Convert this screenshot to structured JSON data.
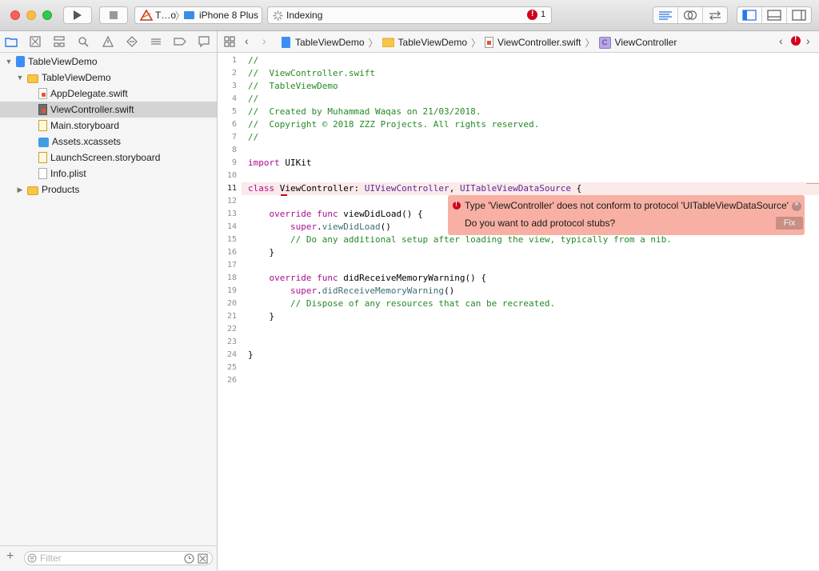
{
  "toolbar": {
    "scheme_name": "T…o",
    "device": "iPhone 8 Plus",
    "activity_text": "Indexing",
    "error_count": "1"
  },
  "navigator": {
    "tree": [
      {
        "label": "TableViewDemo",
        "icon": "project-icon",
        "level": 0,
        "disclosure": "open"
      },
      {
        "label": "TableViewDemo",
        "icon": "folder-icon",
        "level": 1,
        "disclosure": "open"
      },
      {
        "label": "AppDelegate.swift",
        "icon": "swift-file-icon",
        "level": 2
      },
      {
        "label": "ViewController.swift",
        "icon": "swift-file-icon",
        "level": 2,
        "selected": true
      },
      {
        "label": "Main.storyboard",
        "icon": "storyboard-file-icon",
        "level": 2
      },
      {
        "label": "Assets.xcassets",
        "icon": "asset-catalog-icon",
        "level": 2
      },
      {
        "label": "LaunchScreen.storyboard",
        "icon": "storyboard-file-icon",
        "level": 2
      },
      {
        "label": "Info.plist",
        "icon": "plist-file-icon",
        "level": 2
      },
      {
        "label": "Products",
        "icon": "folder-icon",
        "level": 1,
        "disclosure": "closed"
      }
    ],
    "filter_placeholder": "Filter"
  },
  "jumpbar": {
    "crumbs": [
      "TableViewDemo",
      "TableViewDemo",
      "ViewController.swift",
      "ViewController"
    ]
  },
  "editor": {
    "lines": [
      {
        "n": "1",
        "segs": [
          [
            "cm",
            "//"
          ]
        ]
      },
      {
        "n": "2",
        "segs": [
          [
            "cm",
            "//  ViewController.swift"
          ]
        ]
      },
      {
        "n": "3",
        "segs": [
          [
            "cm",
            "//  TableViewDemo"
          ]
        ]
      },
      {
        "n": "4",
        "segs": [
          [
            "cm",
            "//"
          ]
        ]
      },
      {
        "n": "5",
        "segs": [
          [
            "cm",
            "//  Created by Muhammad Waqas on 21/03/2018."
          ]
        ]
      },
      {
        "n": "6",
        "segs": [
          [
            "cm",
            "//  Copyright © 2018 ZZZ Projects. All rights reserved."
          ]
        ]
      },
      {
        "n": "7",
        "segs": [
          [
            "cm",
            "//"
          ]
        ]
      },
      {
        "n": "8",
        "segs": []
      },
      {
        "n": "9",
        "segs": [
          [
            "kw",
            "import"
          ],
          [
            "pl",
            " UIKit"
          ]
        ]
      },
      {
        "n": "10",
        "segs": []
      },
      {
        "n": "11",
        "segs": [
          [
            "kw",
            "class"
          ],
          [
            "pl",
            " ViewController: "
          ],
          [
            "ty",
            "UIViewController"
          ],
          [
            "pl",
            ", "
          ],
          [
            "ty",
            "UITableViewDataSource"
          ],
          [
            "pl",
            " {"
          ]
        ],
        "current": true
      },
      {
        "n": "12",
        "segs": []
      },
      {
        "n": "13",
        "segs": [
          [
            "pl",
            "    "
          ],
          [
            "kw",
            "override"
          ],
          [
            "pl",
            " "
          ],
          [
            "kw",
            "func"
          ],
          [
            "pl",
            " viewDidLoad() {"
          ]
        ]
      },
      {
        "n": "14",
        "segs": [
          [
            "pl",
            "        "
          ],
          [
            "kw",
            "super"
          ],
          [
            "pl",
            "."
          ],
          [
            "fn",
            "viewDidLoad"
          ],
          [
            "pl",
            "()"
          ]
        ]
      },
      {
        "n": "15",
        "segs": [
          [
            "pl",
            "        "
          ],
          [
            "cm",
            "// Do any additional setup after loading the view, typically from a nib."
          ]
        ]
      },
      {
        "n": "16",
        "segs": [
          [
            "pl",
            "    }"
          ]
        ]
      },
      {
        "n": "17",
        "segs": []
      },
      {
        "n": "18",
        "segs": [
          [
            "pl",
            "    "
          ],
          [
            "kw",
            "override"
          ],
          [
            "pl",
            " "
          ],
          [
            "kw",
            "func"
          ],
          [
            "pl",
            " didReceiveMemoryWarning() {"
          ]
        ]
      },
      {
        "n": "19",
        "segs": [
          [
            "pl",
            "        "
          ],
          [
            "kw",
            "super"
          ],
          [
            "pl",
            "."
          ],
          [
            "fn",
            "didReceiveMemoryWarning"
          ],
          [
            "pl",
            "()"
          ]
        ]
      },
      {
        "n": "20",
        "segs": [
          [
            "pl",
            "        "
          ],
          [
            "cm",
            "// Dispose of any resources that can be recreated."
          ]
        ]
      },
      {
        "n": "21",
        "segs": [
          [
            "pl",
            "    }"
          ]
        ]
      },
      {
        "n": "22",
        "segs": []
      },
      {
        "n": "23",
        "segs": []
      },
      {
        "n": "24",
        "segs": [
          [
            "pl",
            "}"
          ]
        ]
      },
      {
        "n": "25",
        "segs": []
      },
      {
        "n": "26",
        "segs": []
      }
    ]
  },
  "error_popup": {
    "message": "Type 'ViewController' does not conform to protocol 'UITableViewDataSource'",
    "suggestion": "Do you want to add protocol stubs?",
    "fix_label": "Fix"
  },
  "colors": {
    "comment": "#258a25",
    "keyword": "#aa0d91",
    "type": "#5c2699",
    "error_bg": "#f7b0a3",
    "error_red": "#d0021b",
    "selection": "#d4d4d4"
  }
}
